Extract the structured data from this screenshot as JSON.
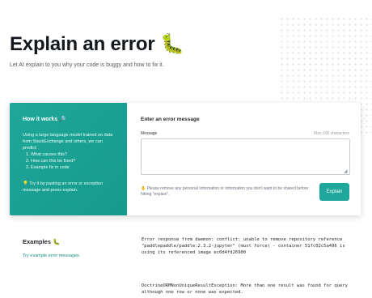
{
  "header": {
    "title": "Explain an error 🐛",
    "subtitle": "Let AI explain to you why your code is buggy and how to fix it."
  },
  "how_it_works": {
    "title": "How it works 🔎",
    "intro": "Using a large language model trained on data from StackExchange and others, we can predict:",
    "steps": [
      "What causes this?",
      "How can this be fixed?",
      "Example fix in code"
    ],
    "tip": "💡 Try it by pasting an error or exception message and press explain."
  },
  "form": {
    "title": "Enter an error message",
    "message_label": "Message",
    "max_chars": "Max 200 characters",
    "message_value": "",
    "notice": "✋ Please remove any personal information or information you don't want to be shared before hitting \"explain\".",
    "explain_label": "Explain"
  },
  "examples": {
    "title": "Examples 🐛",
    "link": "Try example error messages.",
    "items": [
      "Error response from daemon: conflict: unable to remove repository reference \"paddlepaddle/paddle:2.3.2-jupyter\" (must force) - container 51fc02c5a496 is using its referenced image ec0d4fd26900",
      "DoctrineORMNonUniqueResultException: More than one result was found for query although one row or none was expected."
    ]
  },
  "colors": {
    "accent": "#1ea79a",
    "link": "#168a7d"
  }
}
